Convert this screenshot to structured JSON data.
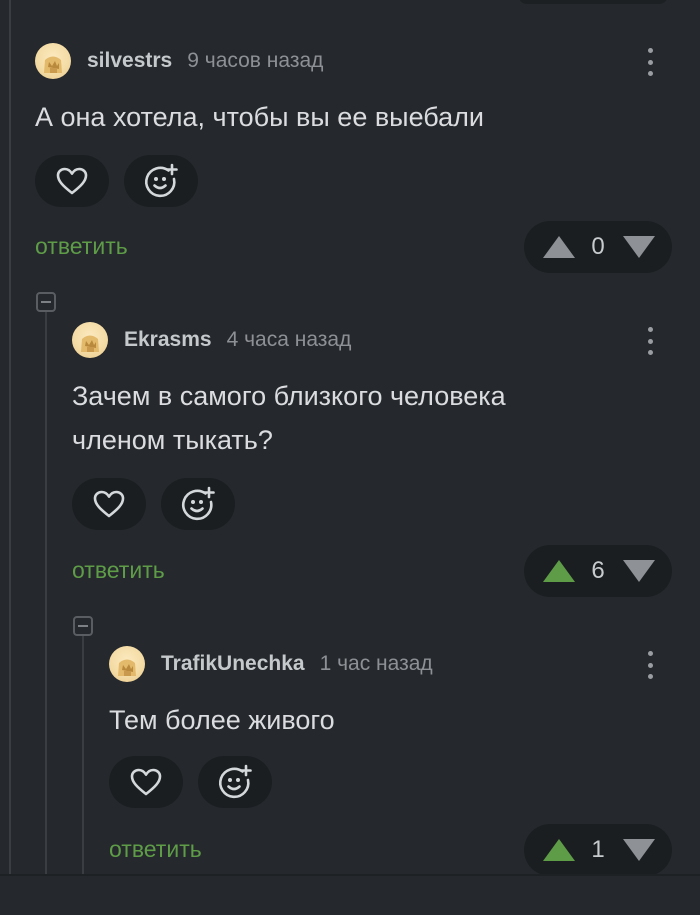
{
  "comments": [
    {
      "username": "silvestrs",
      "time": "9 часов назад",
      "text_lines": [
        "А она хотела, чтобы вы ее выебали"
      ],
      "reply_label": "ответить",
      "rating": "0",
      "upvoted": false
    },
    {
      "username": "Ekrasms",
      "time": "4 часа назад",
      "text_lines": [
        "Зачем в самого близкого человека",
        "членом тыкать?"
      ],
      "reply_label": "ответить",
      "rating": "6",
      "upvoted": true
    },
    {
      "username": "TrafikUnechka",
      "time": "1 час назад",
      "text_lines": [
        "Тем более живого"
      ],
      "reply_label": "ответить",
      "rating": "1",
      "upvoted": true
    }
  ],
  "colors": {
    "background": "#25282c",
    "reply_link": "#5e9c48",
    "upvote_active": "#5e9c48",
    "vote_inactive": "#8e9196"
  },
  "icons": {
    "like": "heart-icon",
    "reaction": "add-emoji-icon",
    "upvote": "arrow-up-icon",
    "downvote": "arrow-down-icon",
    "menu": "more-vertical-icon",
    "collapse": "collapse-thread-icon"
  }
}
